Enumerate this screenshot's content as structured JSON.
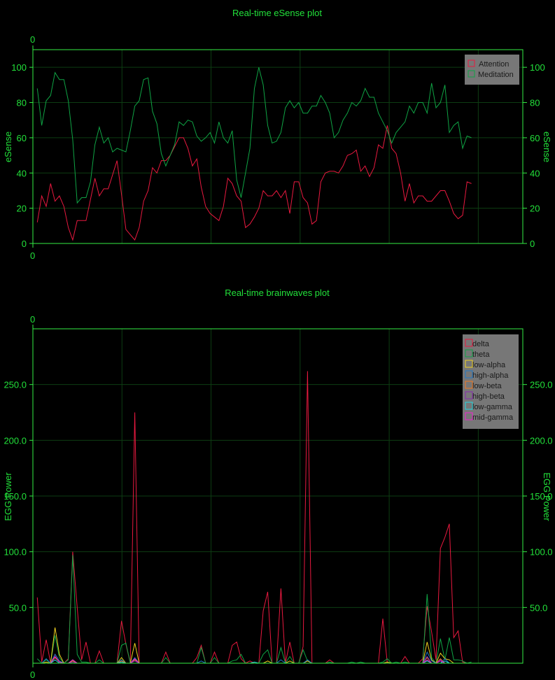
{
  "chart_data": [
    {
      "type": "line",
      "title": "Real-time eSense plot",
      "top_x_label": "0",
      "bottom_x_label": "0",
      "ylabel": "eSense",
      "ylabel_right": "eSense",
      "xlim": [
        0,
        110
      ],
      "ylim": [
        0,
        110
      ],
      "yticks": [
        "0",
        "20",
        "40",
        "60",
        "80",
        "100"
      ],
      "ytick_values": [
        0,
        20,
        40,
        60,
        80,
        100
      ],
      "xgrid": [
        20,
        40,
        60,
        80,
        100
      ],
      "grid": true,
      "legend_position": "top-right",
      "series": [
        {
          "name": "Attention",
          "color": "#e8193f",
          "values": [
            12,
            27,
            21,
            34,
            24,
            27,
            21,
            9,
            2,
            13,
            13,
            13,
            25,
            37,
            27,
            31,
            31,
            39,
            47,
            28,
            8,
            5,
            2,
            9,
            24,
            30,
            43,
            40,
            47,
            47,
            50,
            55,
            60,
            60,
            54,
            44,
            48,
            32,
            21,
            17,
            15,
            13,
            21,
            37,
            34,
            27,
            24,
            9,
            11,
            15,
            20,
            30,
            27,
            27,
            30,
            26,
            30,
            17,
            35,
            35,
            26,
            23,
            11,
            13,
            35,
            40,
            41,
            41,
            40,
            44,
            50,
            51,
            53,
            41,
            44,
            38,
            43,
            56,
            54,
            67,
            54,
            51,
            40,
            24,
            34,
            23,
            27,
            27,
            24,
            24,
            27,
            30,
            30,
            24,
            17,
            14,
            16,
            35,
            34
          ]
        },
        {
          "name": "Meditation",
          "color": "#0fa344",
          "values": [
            88,
            67,
            81,
            84,
            97,
            93,
            93,
            81,
            59,
            23,
            26,
            26,
            35,
            56,
            66,
            57,
            60,
            52,
            54,
            53,
            52,
            64,
            78,
            81,
            93,
            94,
            75,
            68,
            51,
            44,
            50,
            56,
            69,
            67,
            70,
            69,
            61,
            58,
            60,
            63,
            57,
            69,
            60,
            57,
            64,
            36,
            26,
            40,
            54,
            88,
            100,
            90,
            67,
            57,
            58,
            63,
            77,
            81,
            77,
            80,
            74,
            74,
            78,
            78,
            84,
            80,
            74,
            60,
            63,
            70,
            74,
            80,
            78,
            81,
            88,
            83,
            83,
            74,
            69,
            64,
            57,
            63,
            66,
            69,
            78,
            74,
            80,
            80,
            74,
            91,
            77,
            80,
            90,
            63,
            67,
            69,
            54,
            61,
            60
          ]
        }
      ]
    },
    {
      "type": "line",
      "title": "Real-time brainwaves plot",
      "top_x_label": "0",
      "bottom_x_label": "0",
      "ylabel": "EGG Power",
      "ylabel_right": "EGG Power",
      "xlim": [
        0,
        110
      ],
      "ylim": [
        0,
        300
      ],
      "yticks": [
        "50.0",
        "100.0",
        "150.0",
        "200.0",
        "250.0"
      ],
      "ytick_values": [
        50,
        100,
        150,
        200,
        250
      ],
      "xgrid": [
        20,
        40,
        60,
        80,
        100
      ],
      "grid": true,
      "legend_position": "top-right",
      "series": [
        {
          "name": "delta",
          "color": "#e8193f",
          "values": [
            59,
            1,
            21,
            0,
            8,
            2,
            0,
            4,
            100,
            50,
            3,
            19,
            0,
            0,
            11,
            0,
            0,
            0,
            0,
            38,
            17,
            0,
            225,
            0,
            0,
            0,
            0,
            0,
            0,
            10,
            0,
            0,
            0,
            0,
            0,
            0,
            5,
            16,
            0,
            0,
            10,
            0,
            0,
            0,
            16,
            19,
            4,
            0,
            2,
            0,
            0,
            47,
            64,
            0,
            0,
            67,
            0,
            19,
            0,
            0,
            15,
            262,
            0,
            0,
            0,
            0,
            3,
            0,
            0,
            0,
            0,
            0,
            0,
            0,
            0,
            0,
            0,
            0,
            40,
            0,
            0,
            0,
            0,
            6,
            0,
            0,
            0,
            4,
            51,
            28,
            3,
            103,
            113,
            125,
            23,
            29,
            1,
            0,
            0
          ]
        },
        {
          "name": "theta",
          "color": "#0fa344",
          "values": [
            4,
            0,
            3,
            0,
            25,
            5,
            0,
            3,
            97,
            8,
            1,
            1,
            0,
            0,
            3,
            0,
            0,
            0,
            0,
            16,
            18,
            0,
            3,
            0,
            0,
            0,
            0,
            0,
            0,
            5,
            0,
            0,
            0,
            0,
            0,
            0,
            0,
            14,
            0,
            0,
            5,
            0,
            0,
            0,
            2,
            3,
            8,
            0,
            0,
            0,
            0,
            8,
            12,
            0,
            0,
            14,
            0,
            6,
            0,
            0,
            12,
            2,
            0,
            0,
            0,
            0,
            1,
            0,
            0,
            0,
            0,
            1,
            0,
            1,
            0,
            0,
            0,
            0,
            1,
            4,
            0,
            1,
            0,
            1,
            0,
            0,
            0,
            0,
            62,
            5,
            0,
            22,
            3,
            23,
            3,
            3,
            2,
            0,
            1
          ]
        },
        {
          "name": "low-alpha",
          "color": "#f0d020",
          "values": [
            0,
            0,
            1,
            0,
            32,
            8,
            0,
            0,
            3,
            0,
            0,
            0,
            0,
            0,
            0,
            0,
            0,
            0,
            0,
            5,
            0,
            0,
            18,
            0,
            0,
            0,
            0,
            0,
            0,
            0,
            0,
            0,
            0,
            0,
            0,
            0,
            0,
            0,
            0,
            0,
            0,
            0,
            0,
            0,
            0,
            0,
            0,
            0,
            0,
            0,
            0,
            0,
            2,
            0,
            0,
            0,
            0,
            2,
            0,
            0,
            0,
            2,
            0,
            0,
            0,
            0,
            0,
            0,
            0,
            0,
            0,
            0,
            0,
            0,
            0,
            0,
            0,
            0,
            0,
            1,
            0,
            0,
            0,
            0,
            0,
            0,
            0,
            0,
            19,
            3,
            0,
            9,
            4,
            3,
            0,
            0,
            0,
            0,
            0
          ]
        },
        {
          "name": "high-alpha",
          "color": "#1f78c8",
          "values": [
            0,
            0,
            4,
            0,
            8,
            2,
            0,
            0,
            3,
            0,
            0,
            0,
            0,
            0,
            0,
            0,
            0,
            0,
            0,
            3,
            0,
            0,
            5,
            0,
            0,
            0,
            0,
            0,
            0,
            0,
            0,
            0,
            0,
            0,
            0,
            0,
            0,
            2,
            0,
            0,
            0,
            0,
            0,
            0,
            0,
            0,
            0,
            0,
            0,
            0,
            0,
            0,
            0,
            0,
            0,
            3,
            0,
            0,
            0,
            0,
            0,
            3,
            0,
            0,
            0,
            0,
            0,
            0,
            0,
            0,
            0,
            0,
            0,
            0,
            0,
            0,
            0,
            0,
            0,
            0,
            0,
            0,
            0,
            0,
            0,
            0,
            0,
            0,
            10,
            2,
            0,
            0,
            4,
            0,
            0,
            0,
            0,
            0,
            0
          ]
        },
        {
          "name": "low-beta",
          "color": "#f07820",
          "values": [
            0,
            0,
            0,
            0,
            5,
            1,
            0,
            0,
            2,
            0,
            0,
            0,
            0,
            0,
            0,
            0,
            0,
            0,
            0,
            2,
            0,
            0,
            3,
            0,
            0,
            0,
            0,
            0,
            0,
            0,
            0,
            0,
            0,
            0,
            0,
            0,
            0,
            0,
            0,
            0,
            0,
            0,
            0,
            0,
            0,
            0,
            0,
            0,
            0,
            0,
            0,
            0,
            0,
            0,
            0,
            0,
            0,
            0,
            0,
            0,
            0,
            0,
            0,
            0,
            0,
            0,
            0,
            0,
            0,
            0,
            0,
            0,
            0,
            0,
            0,
            0,
            0,
            0,
            0,
            0,
            0,
            0,
            0,
            0,
            0,
            0,
            0,
            0,
            5,
            0,
            0,
            4,
            0,
            0,
            0,
            0,
            0,
            0,
            0
          ]
        },
        {
          "name": "high-beta",
          "color": "#8a2ab0",
          "values": [
            0,
            0,
            0,
            0,
            3,
            0,
            0,
            0,
            1,
            0,
            0,
            0,
            0,
            0,
            0,
            0,
            0,
            0,
            0,
            0,
            0,
            0,
            2,
            0,
            0,
            0,
            0,
            0,
            0,
            0,
            0,
            0,
            0,
            0,
            0,
            0,
            0,
            0,
            0,
            0,
            0,
            0,
            0,
            0,
            0,
            0,
            0,
            0,
            0,
            0,
            0,
            0,
            0,
            0,
            0,
            0,
            0,
            0,
            0,
            0,
            0,
            0,
            0,
            0,
            0,
            0,
            0,
            0,
            0,
            0,
            0,
            0,
            0,
            0,
            0,
            0,
            0,
            0,
            0,
            0,
            0,
            0,
            0,
            0,
            0,
            0,
            0,
            0,
            6,
            0,
            0,
            3,
            0,
            0,
            0,
            0,
            0,
            0,
            0
          ]
        },
        {
          "name": "low-gamma",
          "color": "#20d8e0",
          "values": [
            0,
            0,
            0,
            0,
            3,
            0,
            0,
            0,
            0,
            0,
            0,
            0,
            0,
            0,
            0,
            0,
            0,
            0,
            0,
            1,
            0,
            0,
            0,
            0,
            0,
            0,
            0,
            0,
            0,
            0,
            0,
            0,
            0,
            0,
            0,
            0,
            0,
            0,
            0,
            0,
            0,
            0,
            0,
            0,
            0,
            0,
            0,
            0,
            0,
            1,
            0,
            0,
            0,
            0,
            0,
            0,
            0,
            0,
            0,
            0,
            0,
            0,
            0,
            0,
            0,
            0,
            0,
            0,
            0,
            0,
            0,
            0,
            0,
            0,
            0,
            0,
            0,
            0,
            0,
            0,
            0,
            0,
            0,
            0,
            0,
            0,
            0,
            0,
            2,
            0,
            0,
            0,
            2,
            0,
            0,
            0,
            0,
            0,
            0
          ]
        },
        {
          "name": "mid-gamma",
          "color": "#f020d0",
          "values": [
            0,
            0,
            0,
            0,
            6,
            1,
            0,
            0,
            3,
            0,
            0,
            0,
            0,
            0,
            0,
            0,
            0,
            0,
            0,
            0,
            0,
            0,
            4,
            0,
            0,
            0,
            0,
            0,
            0,
            0,
            0,
            0,
            0,
            0,
            0,
            0,
            0,
            0,
            0,
            0,
            0,
            0,
            0,
            0,
            0,
            0,
            0,
            0,
            0,
            0,
            0,
            0,
            0,
            0,
            0,
            0,
            0,
            0,
            0,
            0,
            0,
            0,
            0,
            0,
            0,
            0,
            0,
            0,
            0,
            0,
            0,
            0,
            0,
            0,
            0,
            0,
            0,
            0,
            0,
            0,
            0,
            0,
            0,
            0,
            0,
            0,
            0,
            0,
            3,
            0,
            0,
            2,
            0,
            0,
            0,
            0,
            0,
            0,
            0
          ]
        }
      ]
    }
  ],
  "colors": {
    "background": "#000000",
    "axis": "#33ee44",
    "grid": "#0d3d12",
    "text": "#22e03a",
    "legend_bg": "#777777"
  }
}
